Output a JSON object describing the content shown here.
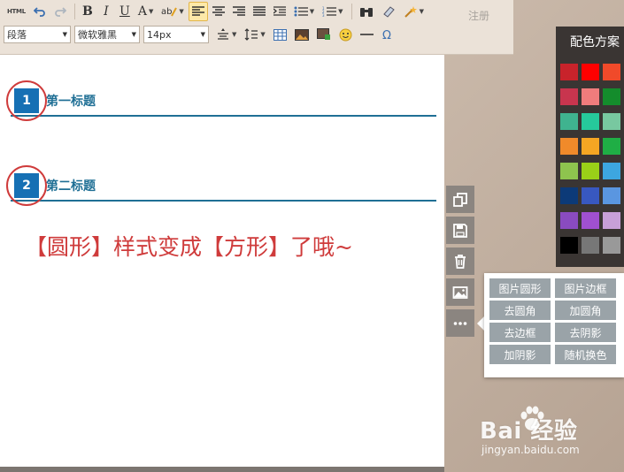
{
  "toolbar": {
    "html_label": "HTML",
    "bold": "B",
    "italic": "I",
    "underline": "U",
    "font_color": "A",
    "paragraph_select": "段落",
    "font_select": "微软雅黑",
    "size_select": "14px",
    "register": "注册"
  },
  "editor": {
    "heading1_number": "1",
    "heading1_text": "第一标题",
    "heading2_number": "2",
    "heading2_text": "第二标题",
    "annotation": "【圆形】样式变成【方形】了哦~"
  },
  "popup": {
    "items": [
      "图片圆形",
      "图片边框",
      "去圆角",
      "加圆角",
      "去边框",
      "去阴影",
      "加阴影",
      "随机换色"
    ]
  },
  "palette": {
    "title": "配色方案",
    "colors": [
      "#c8232b",
      "#ff0000",
      "#f04a2a",
      "#c8354e",
      "#f07c7c",
      "#148c2c",
      "#3fb38f",
      "#26c99b",
      "#78c8a0",
      "#f08a2a",
      "#f5a623",
      "#1fae45",
      "#8ec44e",
      "#9ad018",
      "#3da6e0",
      "#0c3a78",
      "#3858c0",
      "#5a96e0",
      "#8a4bc0",
      "#a050d0",
      "#c8a0d8",
      "#000000",
      "#777777",
      "#999999"
    ]
  },
  "watermark": {
    "logo": "Bai 经验",
    "url": "jingyan.baidu.com"
  },
  "colors": {
    "heading_blue": "#1f6f95",
    "number_box": "#1670b4",
    "annotation_red": "#cf3b3b"
  }
}
